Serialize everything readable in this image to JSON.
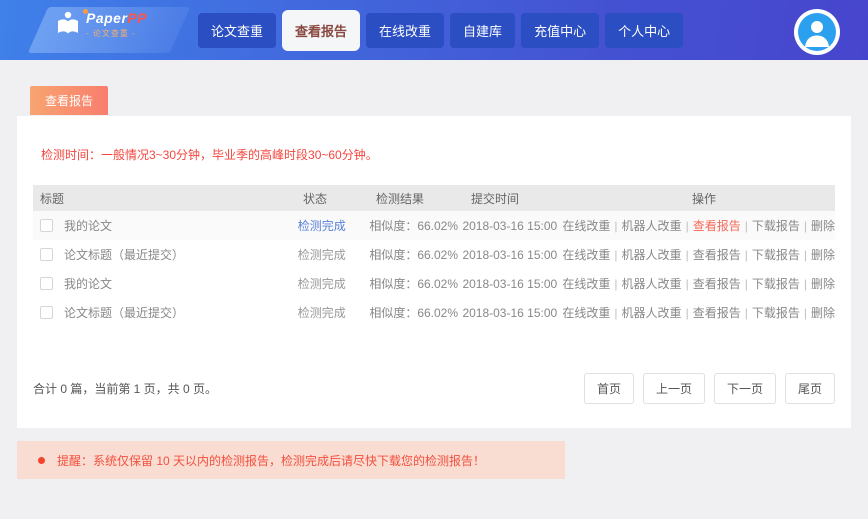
{
  "brand": {
    "name_first": "Paper",
    "name_second": "PP",
    "tagline": "- 论文查重 -"
  },
  "nav": {
    "items": [
      {
        "label": "论文查重",
        "active": false
      },
      {
        "label": "查看报告",
        "active": true
      },
      {
        "label": "在线改重",
        "active": false
      },
      {
        "label": "自建库",
        "active": false
      },
      {
        "label": "充值中心",
        "active": false
      },
      {
        "label": "个人中心",
        "active": false
      }
    ]
  },
  "page": {
    "badge_label": "查看报告",
    "detection_notice": "检测时间：一般情况3~30分钟，毕业季的高峰时段30~60分钟。"
  },
  "table": {
    "headers": {
      "title": "标题",
      "status": "状态",
      "result": "检测结果",
      "time": "提交时间",
      "actions": "操作"
    },
    "action_labels": [
      "在线改重",
      "机器人改重",
      "查看报告",
      "下载报告",
      "删除"
    ],
    "action_separator": "|",
    "rows": [
      {
        "title": "我的论文",
        "status": "检测完成",
        "result": "相似度：66.02%",
        "time": "2018-03-16 15:00"
      },
      {
        "title": "论文标题（最近提交）",
        "status": "检测完成",
        "result": "相似度：66.02%",
        "time": "2018-03-16 15:00"
      },
      {
        "title": "我的论文",
        "status": "检测完成",
        "result": "相似度：66.02%",
        "time": "2018-03-16 15:00"
      },
      {
        "title": "论文标题（最近提交）",
        "status": "检测完成",
        "result": "相似度：66.02%",
        "time": "2018-03-16 15:00"
      }
    ]
  },
  "footer": {
    "summary": "合计 0 篇，当前第 1 页，共 0 页。",
    "pagination": [
      "首页",
      "上一页",
      "下一页",
      "尾页"
    ]
  },
  "reminder": {
    "text": "提醒：系统仅保留 10 天以内的检测报告，检测完成后请尽快下载您的检测报告！"
  },
  "colors": {
    "nav_gradient_start": "#3f80e9",
    "nav_gradient_end": "#4745cd",
    "nav_button": "#2b4ec2",
    "active_tab_text": "#8a4a42",
    "badge_gradient_start": "#f8a471",
    "badge_gradient_end": "#f97e6d",
    "alert_red": "#f5453d",
    "status_link_blue": "#5a82d8",
    "action_red": "#f5695a",
    "reminder_bg": "#f9ddd2",
    "avatar_blue": "#2aa0ee"
  }
}
